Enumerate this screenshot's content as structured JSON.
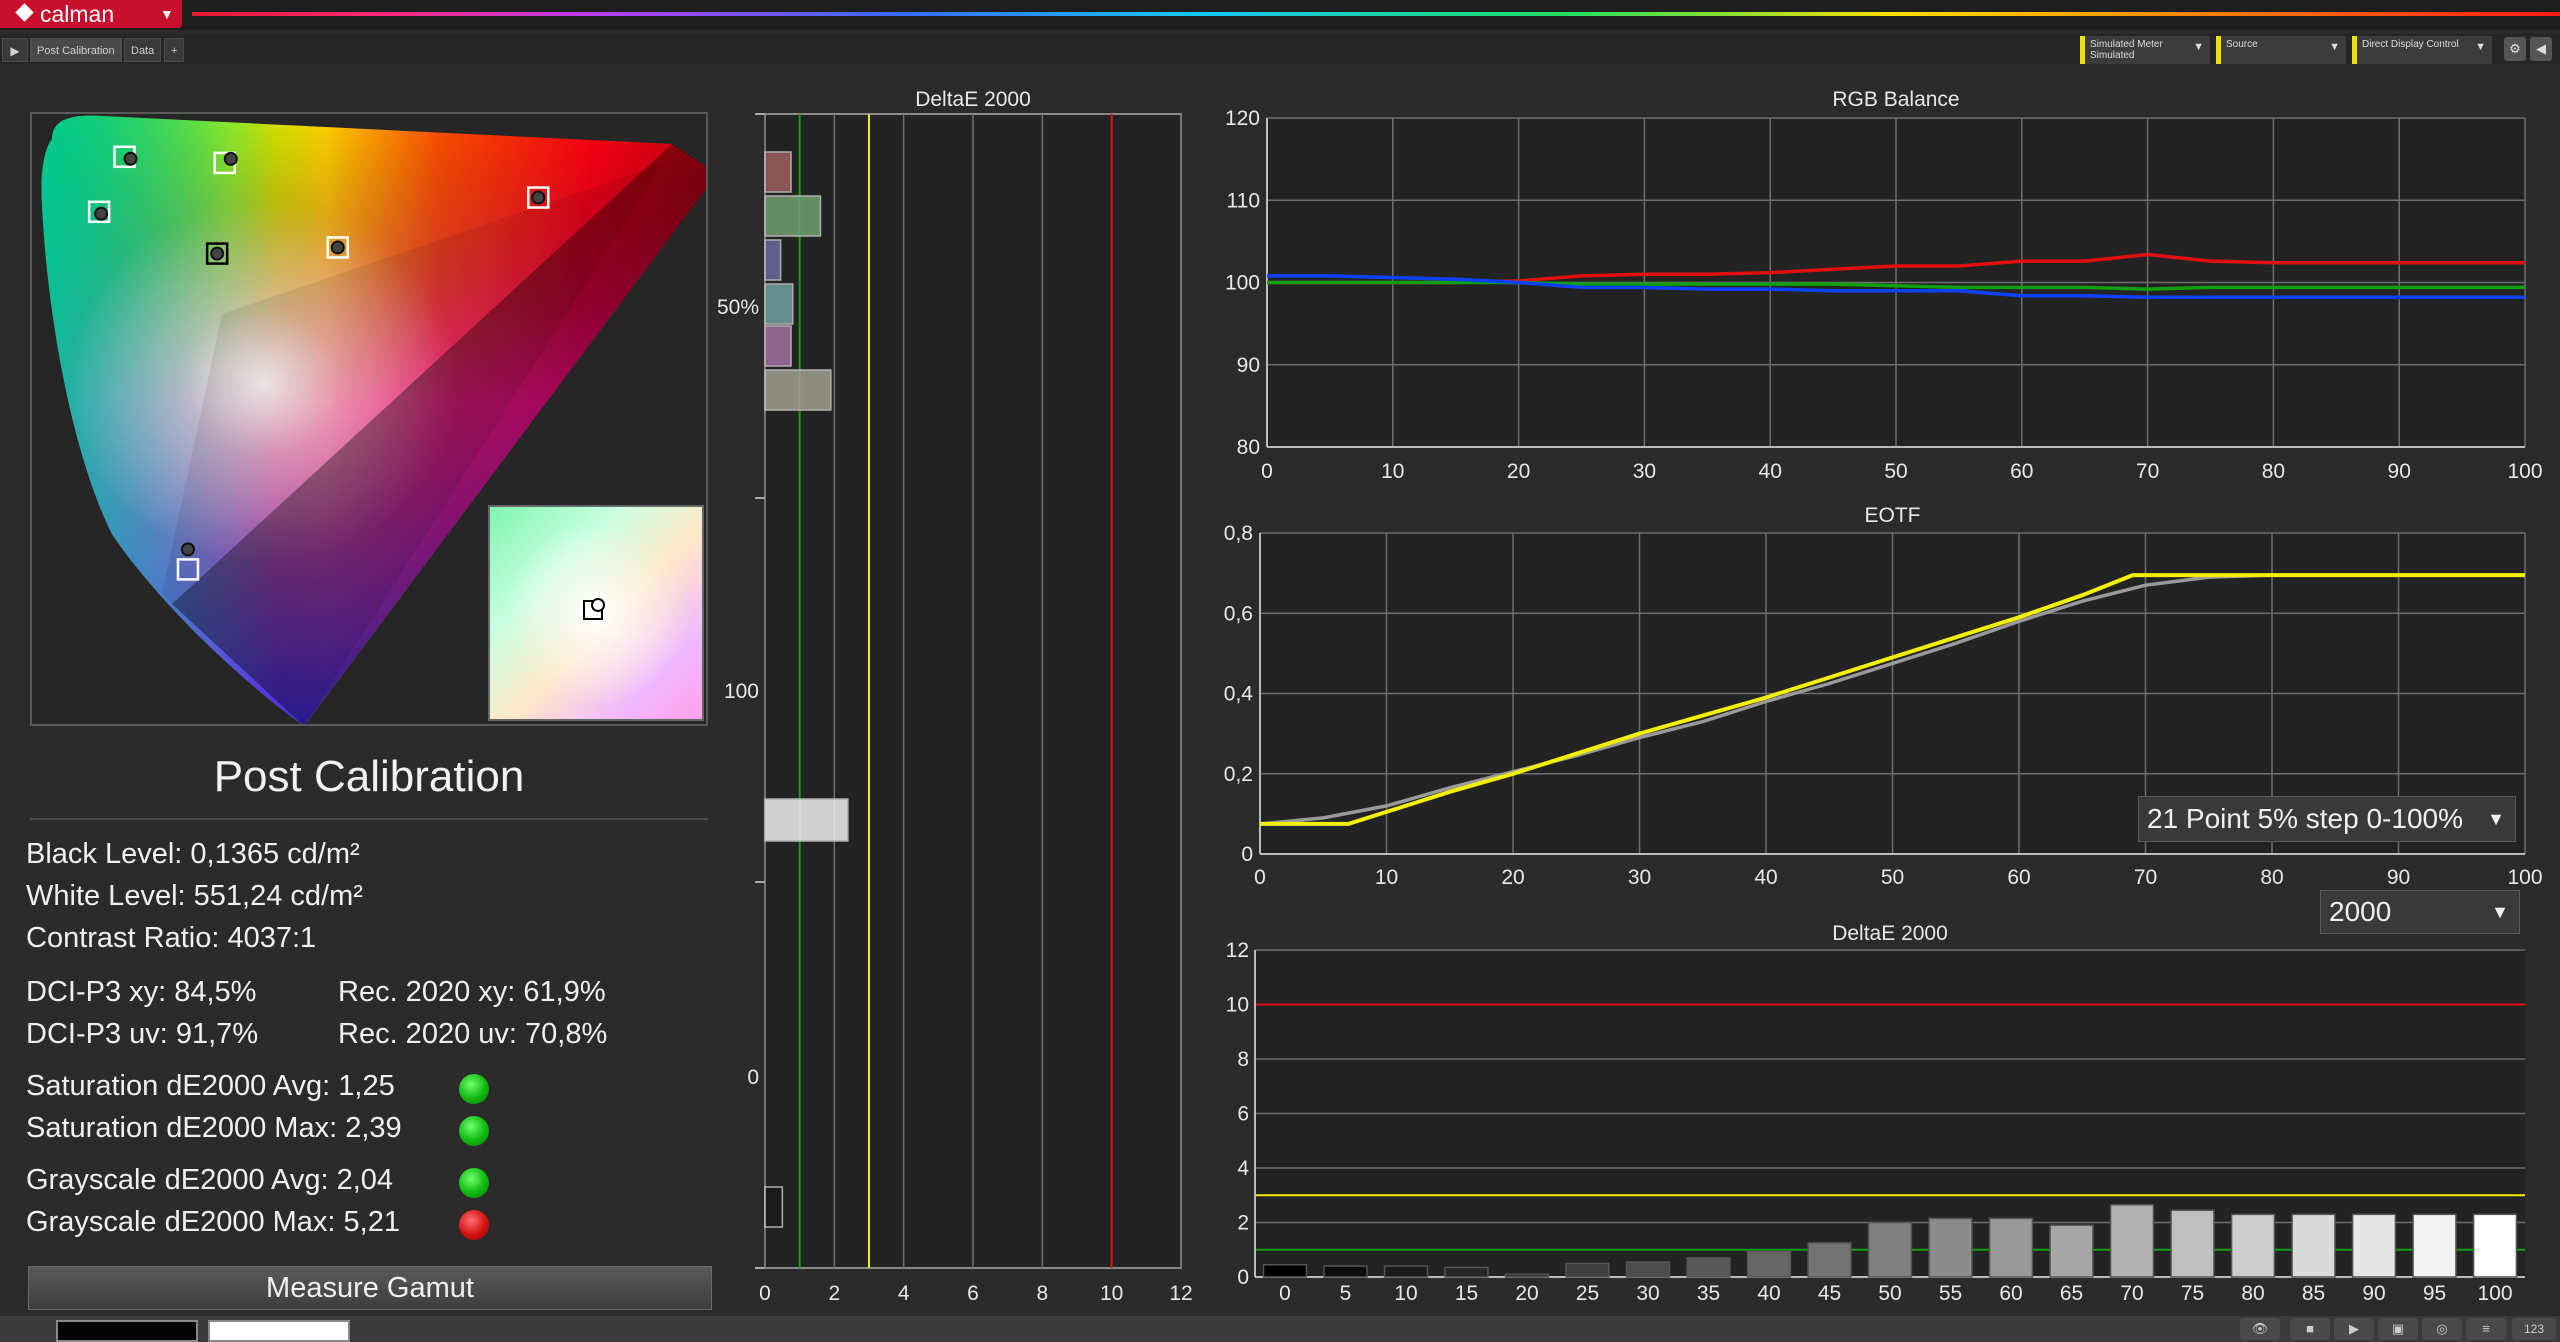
{
  "app": {
    "logo_text": "calman",
    "logo_dropdown": "▼",
    "tabs": [
      "Post Calibration",
      "Data"
    ],
    "tab_add": "+",
    "play_glyph": "▶",
    "controls": [
      {
        "label": "Simulated Meter",
        "value": "Simulated",
        "arrow": "▼"
      },
      {
        "label": "Source",
        "value": "",
        "arrow": "▼"
      },
      {
        "label": "Direct Display Control",
        "value": "",
        "arrow": "▼"
      }
    ],
    "right_buttons": [
      "⚙",
      "◀"
    ]
  },
  "colors": {
    "red": "#e01010",
    "green": "#10a010",
    "blue": "#1040ff",
    "yellow": "#f0f000",
    "gray": "#9a9a9a",
    "grid": "#6e6e6e",
    "accent": "#c8102e"
  },
  "cie": {
    "targets": [
      {
        "name": "green",
        "u": 0.125,
        "v": 0.563
      },
      {
        "name": "yellow",
        "u": 0.204,
        "v": 0.557
      },
      {
        "name": "red",
        "u": 0.451,
        "v": 0.523
      },
      {
        "name": "cyan",
        "u": 0.105,
        "v": 0.509
      },
      {
        "name": "white",
        "u": 0.198,
        "v": 0.468
      },
      {
        "name": "magenta",
        "u": 0.293,
        "v": 0.474
      },
      {
        "name": "blue",
        "u": 0.175,
        "v": 0.158
      }
    ]
  },
  "summary": {
    "title": "Post Calibration",
    "black_level": "Black Level: 0,1365 cd/m²",
    "white_level": "White Level: 551,24 cd/m²",
    "contrast_ratio": "Contrast Ratio: 4037:1",
    "dci_xy": "DCI-P3 xy: 84,5%",
    "rec2020_xy": "Rec. 2020 xy: 61,9%",
    "dci_uv": "DCI-P3 uv: 91,7%",
    "rec2020_uv": "Rec. 2020 uv: 70,8%",
    "sat_avg": "Saturation dE2000 Avg: 1,25",
    "sat_max": "Saturation dE2000 Max: 2,39",
    "gray_avg": "Grayscale dE2000 Avg: 2,04",
    "gray_max": "Grayscale dE2000 Max: 5,21",
    "status": [
      "green",
      "green",
      "green",
      "red"
    ],
    "measure_button": "Measure Gamut"
  },
  "chart_data": [
    {
      "type": "bar",
      "orientation": "horizontal",
      "title": "DeltaE 2000",
      "xlim": [
        0,
        12
      ],
      "x_ticks": [
        "0",
        "2",
        "4",
        "6",
        "8",
        "10",
        "12"
      ],
      "y_tick_labels": [
        "50%",
        "100",
        "0"
      ],
      "thresholds": [
        {
          "value": 1,
          "color": "green"
        },
        {
          "value": 3,
          "color": "yellow"
        },
        {
          "value": 10,
          "color": "red"
        }
      ],
      "bars": [
        {
          "value": 0.75,
          "color": "#a06060"
        },
        {
          "value": 1.6,
          "color": "#70a070"
        },
        {
          "value": 0.45,
          "color": "#6a6aa0"
        },
        {
          "value": 0.8,
          "color": "#70a0a0"
        },
        {
          "value": 0.75,
          "color": "#a070a0"
        },
        {
          "value": 1.9,
          "color": "#a0a090"
        },
        {
          "value": 2.39,
          "color": "#f0f0f0"
        },
        {
          "value": 0.5,
          "color": "#1a1a1a"
        }
      ]
    },
    {
      "type": "line",
      "title": "RGB Balance",
      "xlim": [
        0,
        100
      ],
      "ylim": [
        80,
        120
      ],
      "x_ticks": [
        "0",
        "10",
        "20",
        "30",
        "40",
        "50",
        "60",
        "70",
        "80",
        "90",
        "100"
      ],
      "y_ticks": [
        "80",
        "90",
        "100",
        "110",
        "120"
      ],
      "x": [
        0,
        5,
        10,
        15,
        20,
        25,
        30,
        35,
        40,
        45,
        50,
        55,
        60,
        65,
        70,
        75,
        80,
        85,
        90,
        95,
        100
      ],
      "series": [
        {
          "color": "red",
          "values": [
            100,
            100,
            100,
            100,
            100.2,
            100.8,
            101,
            101,
            101.2,
            101.6,
            102,
            102,
            102.6,
            102.6,
            103.4,
            102.6,
            102.4,
            102.4,
            102.4,
            102.4,
            102.4
          ]
        },
        {
          "color": "green",
          "values": [
            100,
            100,
            100,
            100,
            100,
            99.8,
            99.8,
            99.8,
            99.8,
            99.8,
            99.6,
            99.4,
            99.4,
            99.4,
            99.2,
            99.4,
            99.4,
            99.4,
            99.4,
            99.4,
            99.4
          ]
        },
        {
          "color": "blue",
          "values": [
            100.8,
            100.8,
            100.6,
            100.4,
            100,
            99.4,
            99.4,
            99.2,
            99.2,
            99,
            99,
            99,
            98.4,
            98.4,
            98.2,
            98.2,
            98.2,
            98.2,
            98.2,
            98.2,
            98.2
          ]
        }
      ]
    },
    {
      "type": "line",
      "title": "EOTF",
      "xlim": [
        0,
        100
      ],
      "ylim": [
        0,
        0.8
      ],
      "x_ticks": [
        "0",
        "10",
        "20",
        "30",
        "40",
        "50",
        "60",
        "70",
        "80",
        "90",
        "100"
      ],
      "y_ticks": [
        "0",
        "0,2",
        "0,4",
        "0,6",
        "0,8"
      ],
      "series": [
        {
          "color": "gray",
          "x": [
            0,
            5,
            10,
            15,
            20,
            25,
            30,
            35,
            40,
            45,
            50,
            55,
            60,
            65,
            70,
            75,
            80,
            85,
            90,
            95,
            100
          ],
          "values": [
            0.075,
            0.09,
            0.12,
            0.165,
            0.205,
            0.245,
            0.29,
            0.33,
            0.38,
            0.425,
            0.475,
            0.525,
            0.58,
            0.63,
            0.67,
            0.69,
            0.695,
            0.695,
            0.695,
            0.695,
            0.695
          ]
        },
        {
          "color": "yellow",
          "x": [
            0,
            7,
            10,
            15,
            20,
            25,
            30,
            35,
            40,
            45,
            50,
            55,
            60,
            65,
            69,
            75,
            80,
            85,
            90,
            95,
            100
          ],
          "values": [
            0.075,
            0.075,
            0.105,
            0.155,
            0.2,
            0.25,
            0.3,
            0.345,
            0.39,
            0.44,
            0.49,
            0.54,
            0.59,
            0.645,
            0.695,
            0.695,
            0.695,
            0.695,
            0.695,
            0.695,
            0.695
          ]
        }
      ],
      "dropdown": "21 Point 5% step 0-100%",
      "dropdown_caret": "▼"
    },
    {
      "type": "bar",
      "title": "DeltaE 2000",
      "ylim": [
        0,
        12
      ],
      "y_ticks": [
        "0",
        "2",
        "4",
        "6",
        "8",
        "10",
        "12"
      ],
      "categories": [
        "0",
        "5",
        "10",
        "15",
        "20",
        "25",
        "30",
        "35",
        "40",
        "45",
        "50",
        "55",
        "60",
        "65",
        "70",
        "75",
        "80",
        "85",
        "90",
        "95",
        "100"
      ],
      "values": [
        0.45,
        0.4,
        0.4,
        0.35,
        0.1,
        0.5,
        0.55,
        0.7,
        0.95,
        1.25,
        2.0,
        2.15,
        2.15,
        1.9,
        2.65,
        2.45,
        2.3,
        2.3,
        2.3,
        2.3,
        2.3
      ],
      "thresholds": [
        {
          "value": 1,
          "color": "green"
        },
        {
          "value": 3,
          "color": "yellow"
        },
        {
          "value": 10,
          "color": "red"
        }
      ],
      "dropdown": "2000",
      "dropdown_caret": "▼"
    }
  ],
  "bottom": {
    "buttons": [
      "👁",
      "■",
      "▶",
      "▣",
      "◎",
      "≡"
    ],
    "counter": "123"
  }
}
